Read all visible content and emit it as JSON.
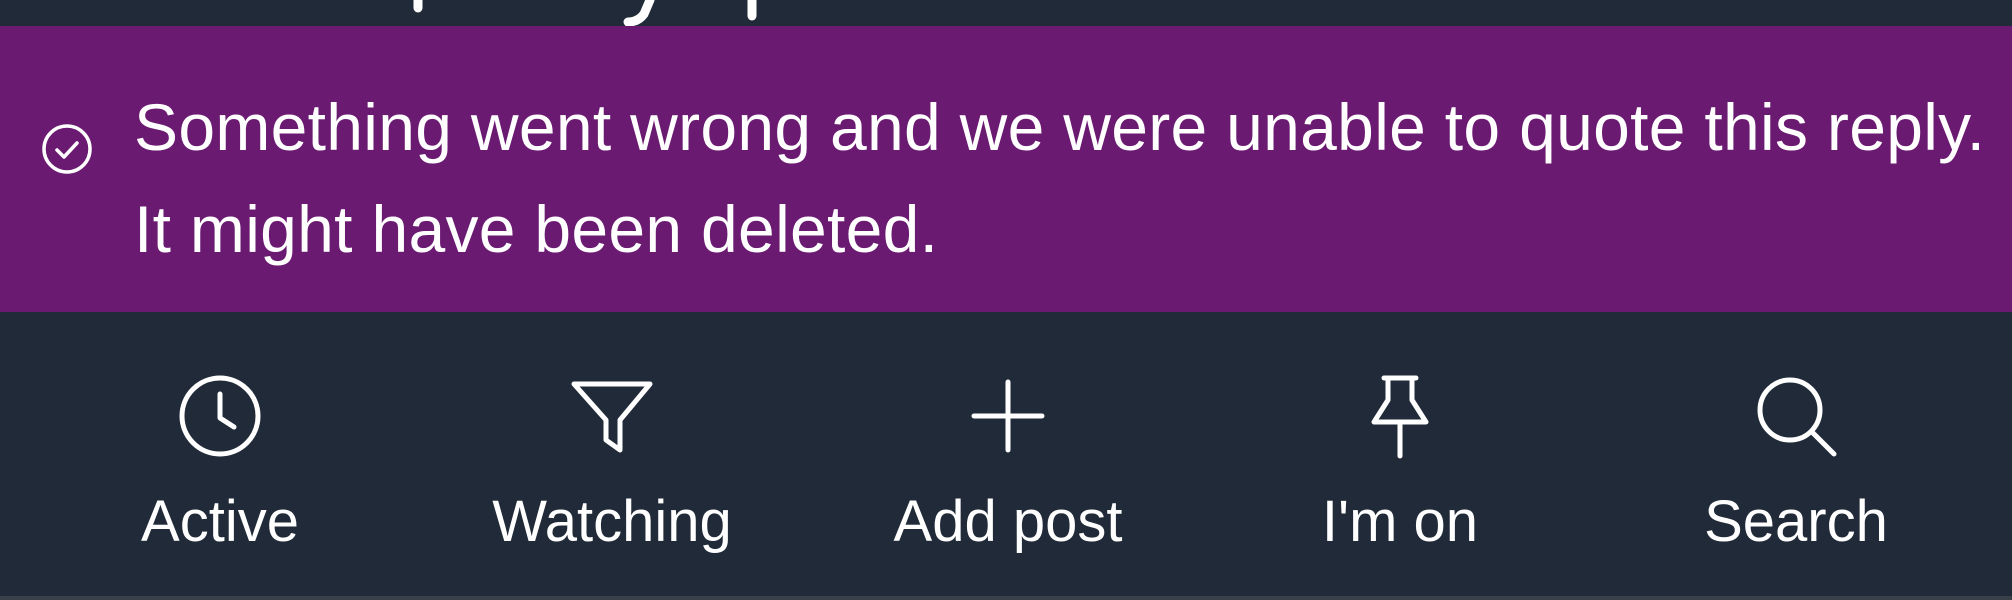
{
  "banner": {
    "status_icon": "check-circle-icon",
    "message": "Something went wrong and we were unable to quote this reply. It might have been deleted.",
    "background_color": "#6b1a72"
  },
  "nav": {
    "background_color": "#212a38",
    "items": [
      {
        "label": "Active",
        "icon": "clock-icon"
      },
      {
        "label": "Watching",
        "icon": "filter-icon"
      },
      {
        "label": "Add post",
        "icon": "plus-icon"
      },
      {
        "label": "I'm on",
        "icon": "pin-icon"
      },
      {
        "label": "Search",
        "icon": "search-icon"
      }
    ]
  }
}
